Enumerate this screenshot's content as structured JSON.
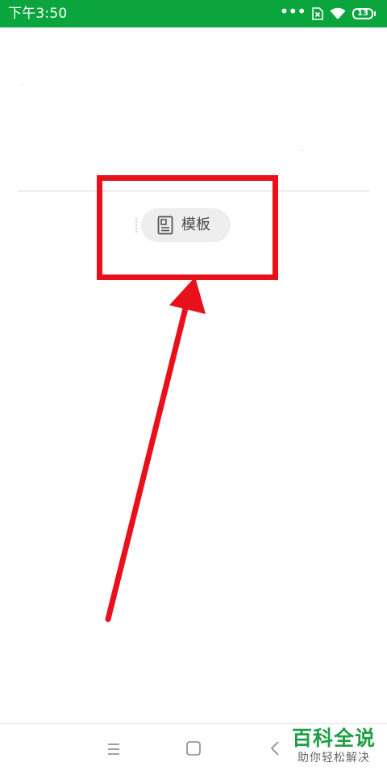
{
  "status_bar": {
    "time": "下午3:50",
    "battery_level": "13",
    "icons": [
      "more-dots-icon",
      "sim-off-icon",
      "wifi-icon",
      "battery-icon"
    ],
    "background_color": "#0aa53c"
  },
  "editor": {
    "template_button": {
      "label": "模板",
      "icon": "template-document-icon"
    }
  },
  "annotation": {
    "highlight_color": "#e8101a",
    "elements": [
      "highlight-box",
      "arrow"
    ]
  },
  "nav_bar": {
    "icons": [
      "menu-icon",
      "home-icon",
      "back-icon"
    ]
  },
  "watermark": {
    "title": "百科全说",
    "subtitle": "助你轻松解决"
  }
}
